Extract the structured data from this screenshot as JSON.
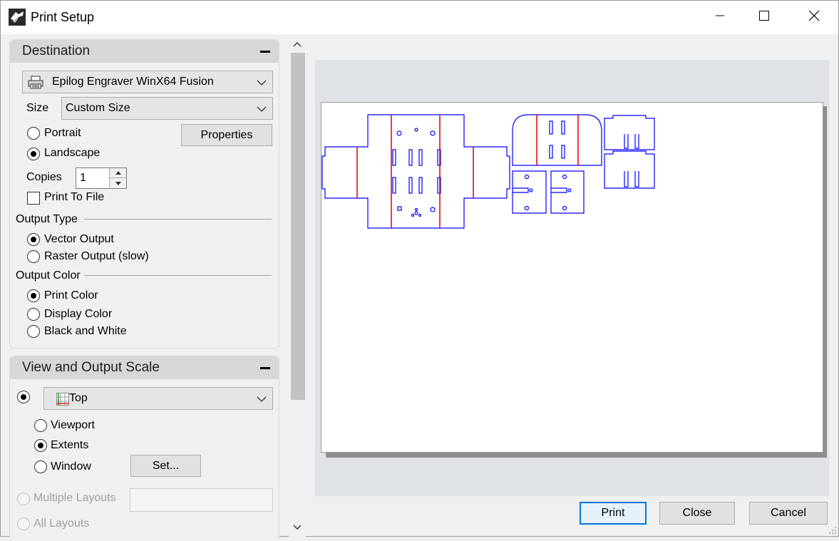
{
  "window": {
    "title": "Print Setup"
  },
  "destination": {
    "header": "Destination",
    "printer": "Epilog Engraver WinX64 Fusion",
    "size_label": "Size",
    "size_value": "Custom Size",
    "orientation": {
      "portrait": "Portrait",
      "landscape": "Landscape",
      "selected": "landscape"
    },
    "properties_button": "Properties",
    "copies_label": "Copies",
    "copies_value": "1",
    "print_to_file": "Print To File",
    "output_type": {
      "label": "Output Type",
      "vector": "Vector Output",
      "raster": "Raster Output (slow)",
      "selected": "vector"
    },
    "output_color": {
      "label": "Output Color",
      "print_color": "Print Color",
      "display_color": "Display Color",
      "black_white": "Black and White",
      "selected": "print_color"
    }
  },
  "view_scale": {
    "header": "View and Output Scale",
    "view_value": "Top",
    "viewport": "Viewport",
    "extents": "Extents",
    "window": "Window",
    "set_button": "Set...",
    "multiple_layouts": "Multiple Layouts",
    "all_layouts": "All Layouts",
    "selected_area": "extents"
  },
  "footer": {
    "print": "Print",
    "close": "Close",
    "cancel": "Cancel"
  },
  "colors": {
    "outline_blue": "#0000ff",
    "fold_red": "#e00000",
    "accent": "#0078d7"
  },
  "icons": [
    "app-icon",
    "minimize-icon",
    "maximize-icon",
    "close-icon",
    "printer-icon",
    "chevron-down-icon",
    "viewport-grid-icon",
    "scroll-up-icon",
    "scroll-down-icon",
    "collapse-icon",
    "resize-grip-icon"
  ]
}
